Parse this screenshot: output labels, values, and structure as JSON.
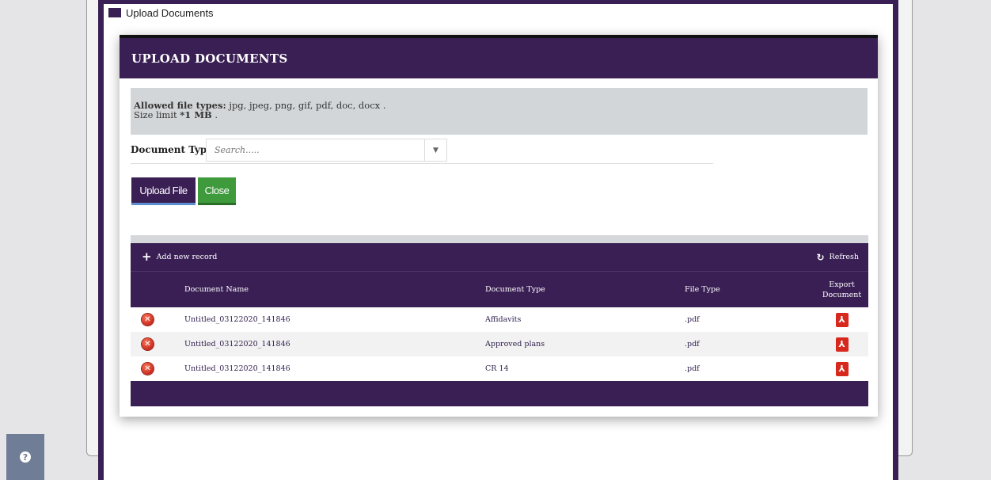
{
  "window": {
    "title": "Upload Documents"
  },
  "modal": {
    "title": "UPLOAD DOCUMENTS",
    "info": {
      "allowed_label": "Allowed file types:",
      "allowed_types": " jpg, jpeg, png, gif, pdf, doc, docx .",
      "size_prefix": "Size limit ",
      "size_value": "*1 MB",
      "size_suffix": " ."
    },
    "document_type": {
      "label": "Document Type",
      "placeholder": "Search....."
    },
    "buttons": {
      "upload": "Upload File",
      "close": "Close"
    }
  },
  "grid": {
    "toolbar": {
      "add": "Add new record",
      "refresh": "Refresh"
    },
    "columns": {
      "name": "Document Name",
      "type": "Document Type",
      "file_type": "File Type",
      "export_line1": "Export",
      "export_line2": "Document"
    },
    "rows": [
      {
        "name": "Untitled_03122020_141846",
        "type": "Affidavits",
        "file_type": ".pdf"
      },
      {
        "name": "Untitled_03122020_141846",
        "type": "Approved plans",
        "file_type": ".pdf"
      },
      {
        "name": "Untitled_03122020_141846",
        "type": "CR 14",
        "file_type": ".pdf"
      }
    ]
  },
  "colors": {
    "primary": "#3a1f55",
    "success": "#3f9a3c",
    "info_bg": "#d3d6d9"
  },
  "icons": {
    "help": "question-circle-icon",
    "delete": "delete-circle-icon",
    "export": "pdf-icon",
    "add": "plus-icon",
    "refresh": "refresh-icon"
  }
}
